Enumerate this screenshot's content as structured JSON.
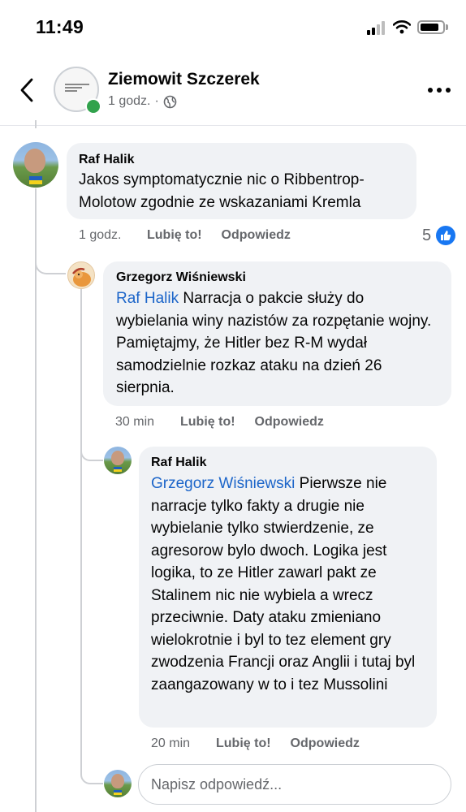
{
  "status_bar": {
    "time": "11:49"
  },
  "header": {
    "author_name": "Ziemowit Szczerek",
    "post_time": "1 godz.",
    "separator": "·"
  },
  "comments": [
    {
      "author": "Raf Halik",
      "text": "Jakos symptomatycznie nic o Ribbentrop-Molotow zgodnie ze wskazaniami Kremla",
      "time": "1 godz.",
      "like_label": "Lubię to!",
      "reply_label": "Odpowiedz",
      "reaction_count": "5"
    },
    {
      "author": "Grzegorz Wiśniewski",
      "mention": "Raf Halik",
      "text": "Narracja o pakcie służy do wybielania winy nazistów za rozpętanie wojny. Pamiętajmy, że Hitler bez R-M wydał samodzielnie rozkaz ataku na dzień 26 sierpnia.",
      "time": "30 min",
      "like_label": "Lubię to!",
      "reply_label": "Odpowiedz"
    },
    {
      "author": "Raf Halik",
      "mention": "Grzegorz Wiśniewski",
      "text": "Pierwsze nie narracje tylko fakty a drugie nie wybielanie tylko stwierdzenie, ze agresorow bylo dwoch. Logika jest logika, to ze Hitler zawarl pakt ze Stalinem nic nie wybiela a wrecz przeciwnie. Daty ataku zmieniano wielokrotnie i byl to tez element gry zwodzenia Francji oraz Anglii i tutaj byl zaangazowany w to i tez Mussolini",
      "time": "20 min",
      "like_label": "Lubię to!",
      "reply_label": "Odpowiedz"
    }
  ],
  "reply_box": {
    "placeholder": "Napisz odpowiedź..."
  },
  "icons": {
    "back": "chevron-left-icon",
    "more": "more-horizontal-icon",
    "audience": "globe-icon",
    "reaction": "thumbs-up-icon"
  },
  "colors": {
    "link": "#1c65c9",
    "bubble": "#f0f2f5",
    "secondary_text": "#65676b",
    "like_blue": "#1877f2",
    "online": "#31a24c"
  }
}
